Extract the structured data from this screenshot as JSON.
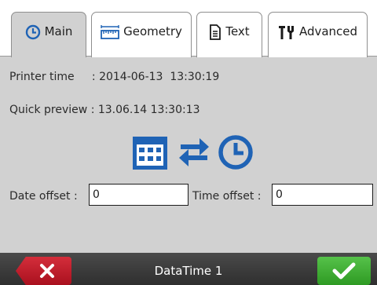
{
  "tabs": [
    {
      "label": "Main",
      "icon": "clock-icon",
      "active": true
    },
    {
      "label": "Geometry",
      "icon": "ruler-icon",
      "active": false
    },
    {
      "label": "Text",
      "icon": "document-icon",
      "active": false
    },
    {
      "label": "Advanced",
      "icon": "tools-icon",
      "active": false
    }
  ],
  "main": {
    "printer_time_label": "Printer time",
    "printer_time_value": ": 2014-06-13  13:30:19",
    "quick_preview_label": "Quick preview",
    "quick_preview_value": ": 13.06.14 13:30:13",
    "date_offset_label": "Date offset :",
    "date_offset_value": "0",
    "time_offset_label": "Time offset :",
    "time_offset_value": "0"
  },
  "footer": {
    "title": "DataTime 1",
    "cancel_icon": "close-icon",
    "ok_icon": "checkmark-icon"
  },
  "colors": {
    "accent_blue": "#1f63b5",
    "cancel_red": "#c21d2b",
    "ok_green": "#3fae35",
    "panel_gray": "#d1d1d1"
  }
}
